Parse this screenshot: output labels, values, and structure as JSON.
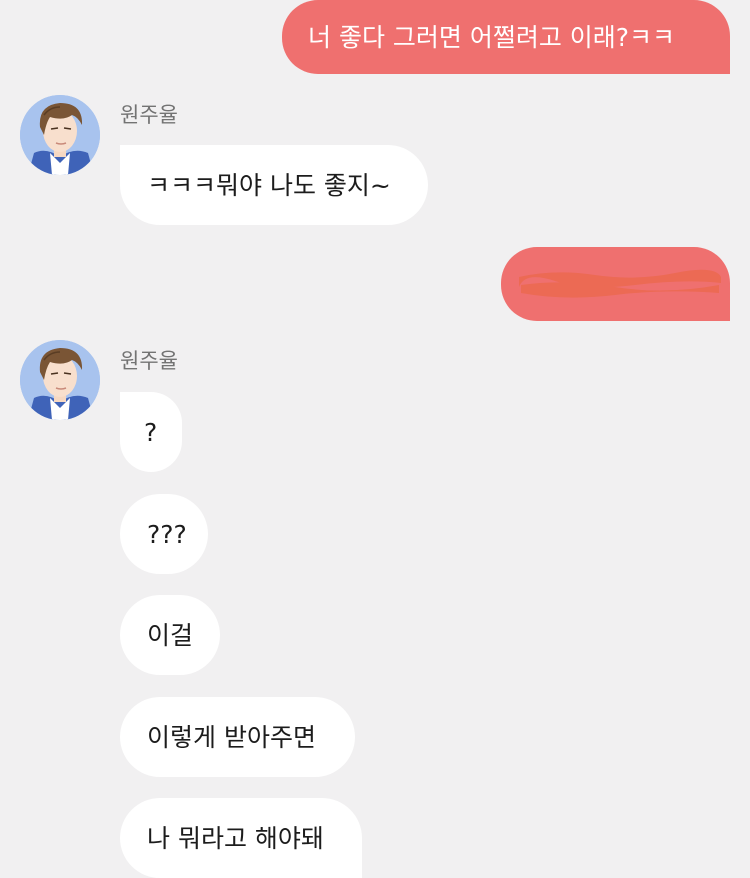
{
  "colors": {
    "background": "#f1f0f1",
    "outgoing_bubble": "#ef706f",
    "incoming_bubble": "#ffffff",
    "redaction_scribble": "#ec6a54"
  },
  "messages": [
    {
      "direction": "outgoing",
      "text": "너 좋다 그러면 어쩔려고 이래?ㅋㅋ"
    },
    {
      "direction": "incoming",
      "sender": "원주율",
      "text": "ㅋㅋㅋ뭐야 나도 좋지~"
    },
    {
      "direction": "outgoing",
      "redacted": true
    },
    {
      "direction": "incoming",
      "sender": "원주율",
      "text": "?"
    },
    {
      "direction": "incoming",
      "text": "???"
    },
    {
      "direction": "incoming",
      "text": "이걸"
    },
    {
      "direction": "incoming",
      "text": "이렇게 받아주면"
    },
    {
      "direction": "incoming",
      "text": "나 뭐라고 해야돼"
    }
  ],
  "icons": {
    "avatar": "profile-avatar-illustrated-boy"
  }
}
